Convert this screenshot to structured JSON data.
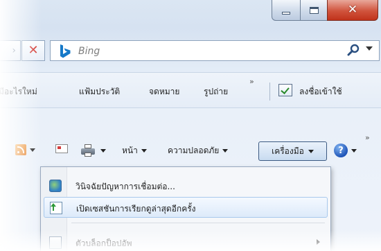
{
  "window": {
    "controls": [
      "minimize",
      "maximize",
      "close"
    ]
  },
  "address": {
    "refresh_icon": "refresh-icon",
    "stop_icon": "stop-icon"
  },
  "search": {
    "placeholder": "Bing",
    "provider_icon": "bing-logo",
    "go_icon": "magnifier-icon"
  },
  "favorites": {
    "items": [
      "มีอะไรใหม่",
      "แฟ้มประวัติ",
      "จดหมาย",
      "รูปถ่าย"
    ],
    "overflow": "»",
    "signin_label": "ลงชื่อเข้าใช้"
  },
  "command_bar": {
    "page_label": "หน้า",
    "safety_label": "ความปลอดภัย",
    "tools_label": "เครื่องมือ",
    "overflow": "»",
    "icons": [
      "feeds-icon",
      "mail-icon",
      "print-icon",
      "help-icon"
    ]
  },
  "tools_menu": {
    "items": [
      {
        "label": "วินิจฉัยปัญหาการเชื่อมต่อ...",
        "icon": "network-diagnose-icon"
      },
      {
        "label": "เปิดเซสชันการเรียกดูล่าสุดอีกครั้ง",
        "icon": "reopen-session-icon",
        "highlighted": true
      },
      {
        "label": "ตัวบล็อกป็อปอัพ",
        "icon": "popup-blocker-icon",
        "submenu": true
      }
    ]
  }
}
